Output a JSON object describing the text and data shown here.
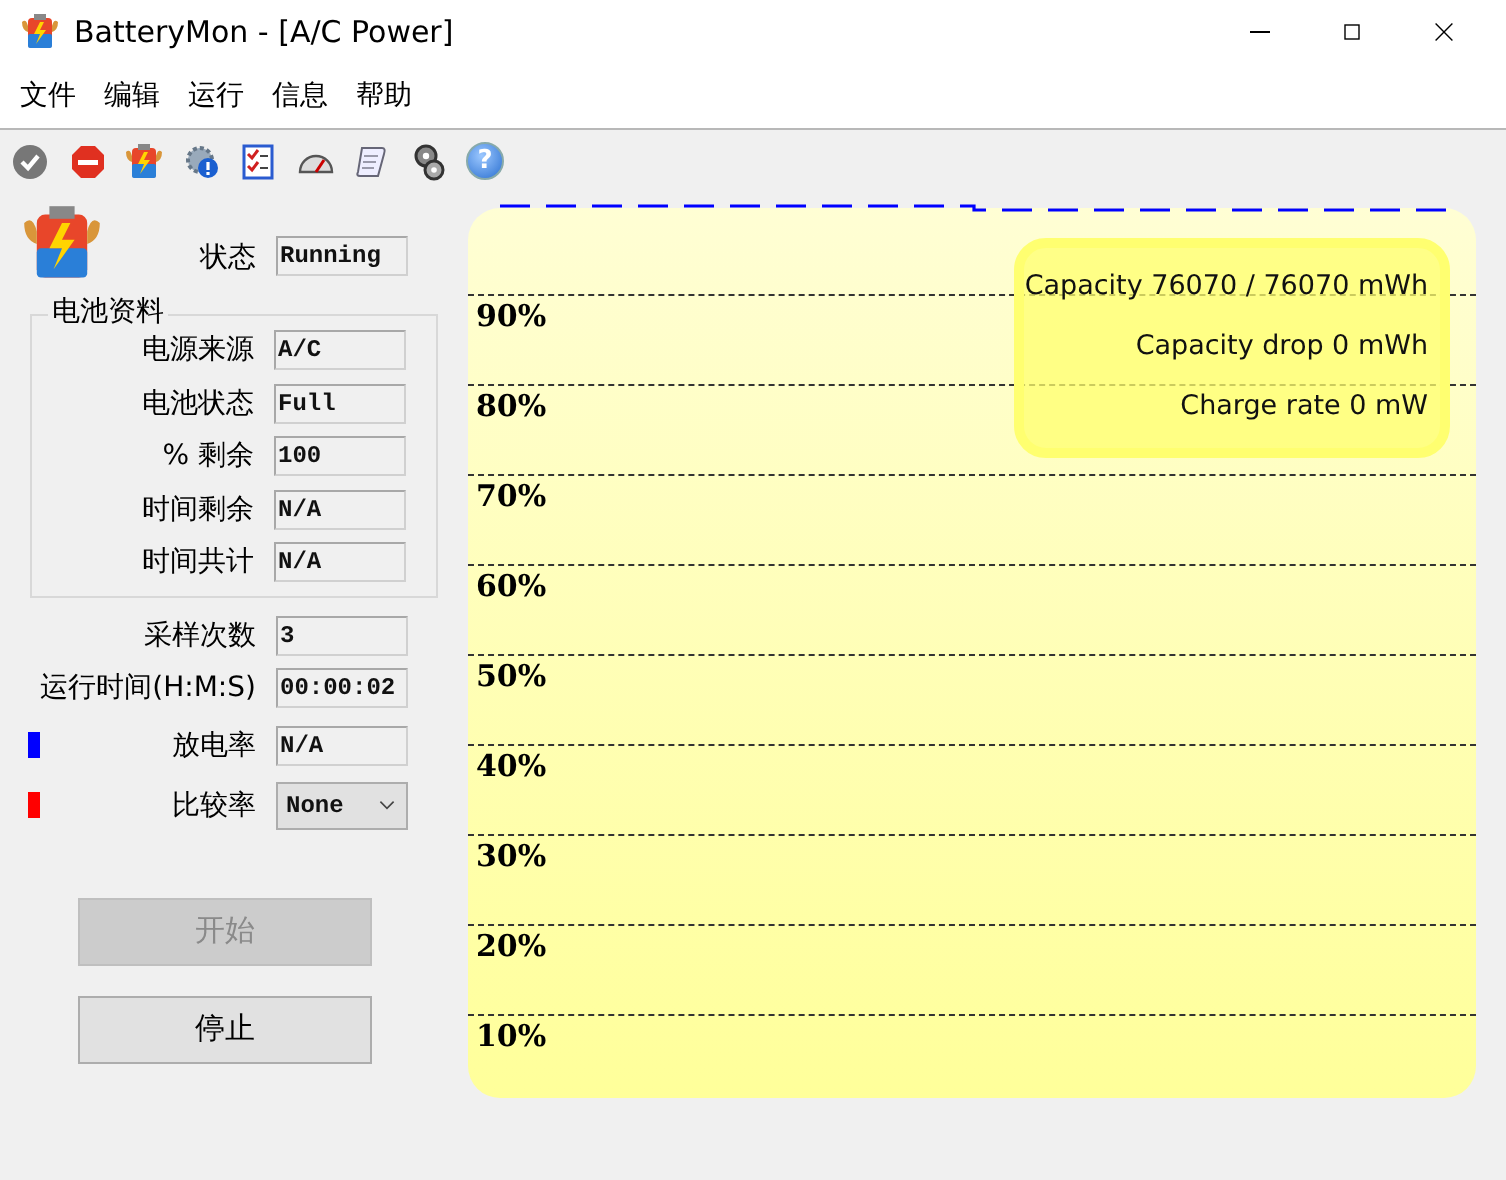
{
  "window": {
    "title": "BatteryMon - [A/C Power]"
  },
  "menu": [
    "文件",
    "编辑",
    "运行",
    "信息",
    "帮助"
  ],
  "toolbar": {
    "help_glyph": "?"
  },
  "status": {
    "label": "状态",
    "value": "Running"
  },
  "battery_info": {
    "title": "电池资料",
    "fields": [
      {
        "label": "电源来源",
        "value": "A/C"
      },
      {
        "label": "电池状态",
        "value": "Full"
      },
      {
        "label": "% 剩余",
        "value": "100"
      },
      {
        "label": "时间剩余",
        "value": "N/A"
      },
      {
        "label": "时间共计",
        "value": "N/A"
      }
    ]
  },
  "stats": [
    {
      "kind": "field",
      "label": "采样次数",
      "value": "3"
    },
    {
      "kind": "field",
      "label": "运行时间(H:M:S)",
      "value": "00:00:02"
    },
    {
      "kind": "legend",
      "label": "放电率",
      "value": "N/A",
      "color": "#0000ff"
    },
    {
      "kind": "dropdown",
      "label": "比较率",
      "value": "None",
      "color": "#ff0000"
    }
  ],
  "buttons": [
    {
      "label": "开始",
      "disabled": true
    },
    {
      "label": "停止",
      "disabled": false
    }
  ],
  "chart": {
    "gridlines": [
      "90%",
      "80%",
      "70%",
      "60%",
      "50%",
      "40%",
      "30%",
      "20%",
      "10%"
    ],
    "info": [
      "Capacity 76070 / 76070 mWh",
      "Capacity drop 0 mWh",
      "Charge rate 0 mW"
    ]
  }
}
